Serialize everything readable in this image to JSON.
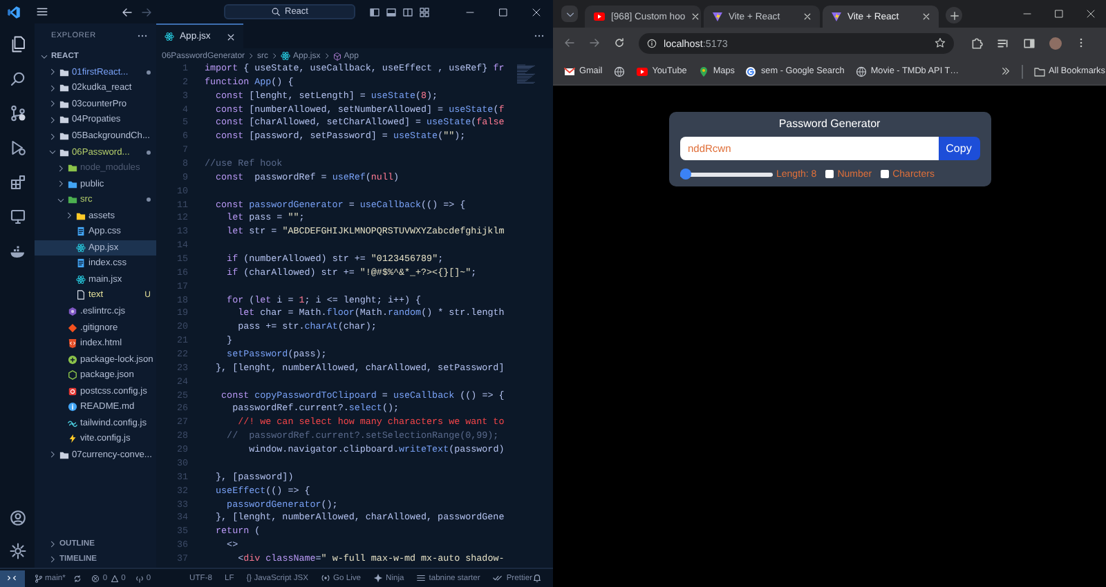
{
  "vscode": {
    "search": "React",
    "explorer": {
      "title": "EXPLORER",
      "root": {
        "label": "REACT",
        "expanded": true
      },
      "tree": [
        {
          "name": "01firstReact...",
          "kind": "folder",
          "expanded": false,
          "selected": false,
          "changed": true,
          "dot": true
        },
        {
          "name": "02kudka_react",
          "kind": "folder",
          "expanded": false,
          "selected": false
        },
        {
          "name": "03counterPro",
          "kind": "folder",
          "expanded": false,
          "selected": false
        },
        {
          "name": "04Propaties",
          "kind": "folder",
          "expanded": false,
          "selected": false
        },
        {
          "name": "05BackgroundCh...",
          "kind": "folder",
          "expanded": false,
          "selected": false
        },
        {
          "name": "06Password...",
          "kind": "folder",
          "expanded": true,
          "selected": false,
          "untracked": true,
          "dot": true,
          "children": [
            {
              "name": "node_modules",
              "kind": "folder-node",
              "expanded": false,
              "selected": false,
              "dimmed": true
            },
            {
              "name": "public",
              "kind": "folder-public",
              "expanded": false,
              "selected": false
            },
            {
              "name": "src",
              "kind": "folder-src",
              "expanded": true,
              "selected": false,
              "untracked": true,
              "dot": true,
              "children": [
                {
                  "name": "assets",
                  "kind": "folder-assets",
                  "expanded": false,
                  "selected": false
                },
                {
                  "name": "App.css",
                  "kind": "css",
                  "selected": false
                },
                {
                  "name": "App.jsx",
                  "kind": "jsx",
                  "selected": true
                },
                {
                  "name": "index.css",
                  "kind": "css",
                  "selected": false
                },
                {
                  "name": "main.jsx",
                  "kind": "jsx",
                  "selected": false
                },
                {
                  "name": "text",
                  "kind": "text",
                  "selected": false,
                  "added": true,
                  "badge": "U"
                }
              ]
            },
            {
              "name": ".eslintrc.cjs",
              "kind": "eslint",
              "selected": false
            },
            {
              "name": ".gitignore",
              "kind": "git",
              "selected": false
            },
            {
              "name": "index.html",
              "kind": "html",
              "selected": false
            },
            {
              "name": "package-lock.json",
              "kind": "lock",
              "selected": false
            },
            {
              "name": "package.json",
              "kind": "node",
              "selected": false
            },
            {
              "name": "postcss.config.js",
              "kind": "postcss",
              "selected": false
            },
            {
              "name": "README.md",
              "kind": "md",
              "selected": false
            },
            {
              "name": "tailwind.config.js",
              "kind": "tailwind",
              "selected": false
            },
            {
              "name": "vite.config.js",
              "kind": "vite",
              "selected": false
            }
          ]
        },
        {
          "name": "07currency-conve...",
          "kind": "folder",
          "expanded": false,
          "selected": false
        }
      ]
    },
    "sections": [
      {
        "label": "OUTLINE",
        "expanded": false
      },
      {
        "label": "TIMELINE",
        "expanded": false
      }
    ],
    "tab": {
      "label": "App.jsx"
    },
    "breadcrumb": [
      {
        "label": "06PasswordGenerator",
        "kind": "text"
      },
      {
        "label": "src",
        "kind": "text"
      },
      {
        "label": "App.jsx",
        "kind": "jsx"
      },
      {
        "label": "App",
        "kind": "symbol"
      }
    ],
    "code": [
      {
        "number": "1",
        "tokens": [
          {
            "text": "import",
            "kind": "kw"
          },
          {
            "text": " { useState, useCallback, useEffect , useRef} ",
            "kind": "plain"
          },
          {
            "text": "fr",
            "kind": "kw"
          }
        ]
      },
      {
        "number": "2",
        "tokens": [
          {
            "text": "function",
            "kind": "kw"
          },
          {
            "text": " App",
            "kind": "fn"
          },
          {
            "text": "() {",
            "kind": "plain"
          }
        ]
      },
      {
        "number": "3",
        "tokens": [
          {
            "text": "  const",
            "kind": "kw"
          },
          {
            "text": " [lenght, setLength] = ",
            "kind": "plain"
          },
          {
            "text": "useState",
            "kind": "fn"
          },
          {
            "text": "(",
            "kind": "plain"
          },
          {
            "text": "8",
            "kind": "num"
          },
          {
            "text": ");",
            "kind": "plain"
          }
        ]
      },
      {
        "number": "4",
        "tokens": [
          {
            "text": "  const",
            "kind": "kw"
          },
          {
            "text": " [numberAllowed, setNumberAllowed] = ",
            "kind": "plain"
          },
          {
            "text": "useState",
            "kind": "fn"
          },
          {
            "text": "(",
            "kind": "plain"
          },
          {
            "text": "f",
            "kind": "num"
          }
        ]
      },
      {
        "number": "5",
        "tokens": [
          {
            "text": "  const",
            "kind": "kw"
          },
          {
            "text": " [charAllowed, setCharAllowed] = ",
            "kind": "plain"
          },
          {
            "text": "useState",
            "kind": "fn"
          },
          {
            "text": "(",
            "kind": "plain"
          },
          {
            "text": "false",
            "kind": "num"
          }
        ]
      },
      {
        "number": "6",
        "tokens": [
          {
            "text": "  const",
            "kind": "kw"
          },
          {
            "text": " [password, setPassword] = ",
            "kind": "plain"
          },
          {
            "text": "useState",
            "kind": "fn"
          },
          {
            "text": "(",
            "kind": "plain"
          },
          {
            "text": "\"\"",
            "kind": "str"
          },
          {
            "text": ");",
            "kind": "plain"
          }
        ]
      },
      {
        "number": "7"
      },
      {
        "number": "8",
        "tokens": [
          {
            "text": "//use Ref hook",
            "kind": "cmt"
          }
        ]
      },
      {
        "number": "9",
        "tokens": [
          {
            "text": "  const",
            "kind": "kw"
          },
          {
            "text": "  passwordRef = ",
            "kind": "plain"
          },
          {
            "text": "useRef",
            "kind": "fn"
          },
          {
            "text": "(",
            "kind": "plain"
          },
          {
            "text": "null",
            "kind": "num"
          },
          {
            "text": ")",
            "kind": "plain"
          }
        ]
      },
      {
        "number": "10"
      },
      {
        "number": "11",
        "tokens": [
          {
            "text": "  const",
            "kind": "kw"
          },
          {
            "text": " passwordGenerator",
            "kind": "fn"
          },
          {
            "text": " = ",
            "kind": "plain"
          },
          {
            "text": "useCallback",
            "kind": "fn"
          },
          {
            "text": "(() => {",
            "kind": "plain"
          }
        ]
      },
      {
        "number": "12",
        "tokens": [
          {
            "text": "    let",
            "kind": "kw"
          },
          {
            "text": " pass = ",
            "kind": "plain"
          },
          {
            "text": "\"\"",
            "kind": "str"
          },
          {
            "text": ";",
            "kind": "plain"
          }
        ]
      },
      {
        "number": "13",
        "tokens": [
          {
            "text": "    let",
            "kind": "kw"
          },
          {
            "text": " str = ",
            "kind": "plain"
          },
          {
            "text": "\"ABCDEFGHIJKLMNOPQRSTUVWXYZabcdefghijklm",
            "kind": "str"
          }
        ]
      },
      {
        "number": "14"
      },
      {
        "number": "15",
        "tokens": [
          {
            "text": "    if",
            "kind": "kw"
          },
          {
            "text": " (numberAllowed) str += ",
            "kind": "plain"
          },
          {
            "text": "\"0123456789\"",
            "kind": "str"
          },
          {
            "text": ";",
            "kind": "plain"
          }
        ]
      },
      {
        "number": "16",
        "tokens": [
          {
            "text": "    if",
            "kind": "kw"
          },
          {
            "text": " (charAllowed) str += ",
            "kind": "plain"
          },
          {
            "text": "\"!@#$%^&*_+?><{}[]~\"",
            "kind": "str"
          },
          {
            "text": ";",
            "kind": "plain"
          }
        ]
      },
      {
        "number": "17"
      },
      {
        "number": "18",
        "tokens": [
          {
            "text": "    for",
            "kind": "kw"
          },
          {
            "text": " (",
            "kind": "plain"
          },
          {
            "text": "let",
            "kind": "kw"
          },
          {
            "text": " i = ",
            "kind": "plain"
          },
          {
            "text": "1",
            "kind": "num"
          },
          {
            "text": "; i <= lenght; i++) {",
            "kind": "plain"
          }
        ]
      },
      {
        "number": "19",
        "tokens": [
          {
            "text": "      let",
            "kind": "kw"
          },
          {
            "text": " char = Math.",
            "kind": "plain"
          },
          {
            "text": "floor",
            "kind": "fn"
          },
          {
            "text": "(Math.",
            "kind": "plain"
          },
          {
            "text": "random",
            "kind": "fn"
          },
          {
            "text": "() * str.length",
            "kind": "plain"
          }
        ]
      },
      {
        "number": "20",
        "tokens": [
          {
            "text": "      pass += str.",
            "kind": "plain"
          },
          {
            "text": "charAt",
            "kind": "fn"
          },
          {
            "text": "(char);",
            "kind": "plain"
          }
        ]
      },
      {
        "number": "21",
        "tokens": [
          {
            "text": "    }",
            "kind": "plain"
          }
        ]
      },
      {
        "number": "22",
        "tokens": [
          {
            "text": "    setPassword",
            "kind": "fn"
          },
          {
            "text": "(pass);",
            "kind": "plain"
          }
        ]
      },
      {
        "number": "23",
        "tokens": [
          {
            "text": "  }, [lenght, numberAllowed, charAllowed, setPassword]",
            "kind": "plain"
          }
        ]
      },
      {
        "number": "24"
      },
      {
        "number": "25",
        "tokens": [
          {
            "text": "   const",
            "kind": "kw"
          },
          {
            "text": " copyPasswordToClipoard",
            "kind": "fn"
          },
          {
            "text": " = ",
            "kind": "plain"
          },
          {
            "text": "useCallback",
            "kind": "fn"
          },
          {
            "text": " (() => {",
            "kind": "plain"
          }
        ]
      },
      {
        "number": "26",
        "tokens": [
          {
            "text": "     passwordRef.current?.",
            "kind": "plain"
          },
          {
            "text": "select",
            "kind": "fn"
          },
          {
            "text": "();",
            "kind": "plain"
          }
        ]
      },
      {
        "number": "27",
        "tokens": [
          {
            "text": "      //! we can select how many characters we want to",
            "kind": "alert"
          }
        ]
      },
      {
        "number": "28",
        "tokens": [
          {
            "text": "    //  passwordRef.current?.setSelectionRange(0,99);",
            "kind": "cmt"
          }
        ]
      },
      {
        "number": "29",
        "tokens": [
          {
            "text": "        window.navigator.clipboard.",
            "kind": "plain"
          },
          {
            "text": "writeText",
            "kind": "fn"
          },
          {
            "text": "(password)",
            "kind": "plain"
          }
        ]
      },
      {
        "number": "30"
      },
      {
        "number": "31",
        "tokens": [
          {
            "text": "  }, [password])",
            "kind": "plain"
          }
        ]
      },
      {
        "number": "32",
        "tokens": [
          {
            "text": "  useEffect",
            "kind": "fn"
          },
          {
            "text": "(() => {",
            "kind": "plain"
          }
        ]
      },
      {
        "number": "33",
        "tokens": [
          {
            "text": "    passwordGenerator",
            "kind": "fn"
          },
          {
            "text": "();",
            "kind": "plain"
          }
        ]
      },
      {
        "number": "34",
        "tokens": [
          {
            "text": "  }, [lenght, numberAllowed, charAllowed, passwordGene",
            "kind": "plain"
          }
        ]
      },
      {
        "number": "35",
        "tokens": [
          {
            "text": "  return",
            "kind": "kw"
          },
          {
            "text": " (",
            "kind": "plain"
          }
        ]
      },
      {
        "number": "36",
        "tokens": [
          {
            "text": "    <>",
            "kind": "plain"
          }
        ]
      },
      {
        "number": "37",
        "tokens": [
          {
            "text": "      <",
            "kind": "plain"
          },
          {
            "text": "div",
            "kind": "tag"
          },
          {
            "text": " className",
            "kind": "attr"
          },
          {
            "text": "=",
            "kind": "plain"
          },
          {
            "text": "\" w-full max-w-md mx-auto shadow-",
            "kind": "str"
          }
        ]
      }
    ],
    "status_left": {
      "branch": "main*",
      "errors": "0",
      "warnings": "0",
      "ports": "0"
    },
    "status_right": [
      {
        "label": "UTF-8",
        "kind": "plain"
      },
      {
        "label": "LF",
        "kind": "plain"
      },
      {
        "label": "{} JavaScript JSX",
        "kind": "plain"
      },
      {
        "label": "Go Live",
        "kind": "live"
      },
      {
        "label": "Ninja",
        "kind": "ninja"
      },
      {
        "label": "tabnine starter",
        "kind": "tabnine"
      },
      {
        "label": "Prettier",
        "kind": "prettier"
      }
    ]
  },
  "browser": {
    "tabs": [
      {
        "title": "[968] Custom hoo",
        "kind": "video",
        "selected": false
      },
      {
        "title": "Vite + React",
        "kind": "vite",
        "selected": false
      },
      {
        "title": "Vite + React",
        "kind": "vite",
        "selected": true
      }
    ],
    "url_host": "localhost",
    "url_rest": ":5173",
    "bookmarks": [
      {
        "label": "Gmail",
        "kind": "mail"
      },
      {
        "kind": "globe"
      },
      {
        "label": "YouTube",
        "kind": "video"
      },
      {
        "label": "Maps",
        "kind": "pin"
      },
      {
        "label": "sem - Google Search",
        "kind": "google"
      },
      {
        "label": "Movie - TMDb API T…",
        "kind": "globe"
      }
    ],
    "all_bookmarks": "All Bookmarks",
    "page": {
      "title": "Password Generator",
      "password": "nddRcwn",
      "copy": "Copy",
      "length_slider": {
        "level": 0.02
      },
      "length_label": "Length: 8",
      "options": [
        {
          "label": "Number",
          "checked": false
        },
        {
          "label": "Charcters",
          "checked": false
        }
      ]
    }
  }
}
